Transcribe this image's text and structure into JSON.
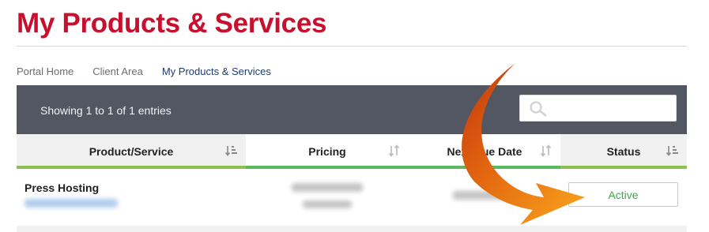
{
  "page": {
    "title": "My Products & Services"
  },
  "breadcrumb": [
    {
      "label": "Portal Home"
    },
    {
      "label": "Client Area"
    },
    {
      "label": "My Products & Services"
    }
  ],
  "table": {
    "entries_info": "Showing 1 to 1 of 1 entries",
    "search": {
      "placeholder": "",
      "value": ""
    },
    "columns": [
      {
        "label": "Product/Service",
        "sort_icon": "sort-amount-down-icon"
      },
      {
        "label": "Pricing",
        "sort_icon": "sort-arrows-icon"
      },
      {
        "label": "Next Due Date",
        "sort_icon": "sort-arrows-icon"
      },
      {
        "label": "Status",
        "sort_icon": "sort-amount-down-icon"
      }
    ],
    "rows": [
      {
        "product": "Press Hosting",
        "status": "Active"
      }
    ]
  },
  "colors": {
    "title_red": "#c8102e",
    "header_bar": "#525761",
    "active_green": "#3fa64a",
    "column_underline": "#8cc152",
    "arrow_orange": "#f08a10"
  }
}
